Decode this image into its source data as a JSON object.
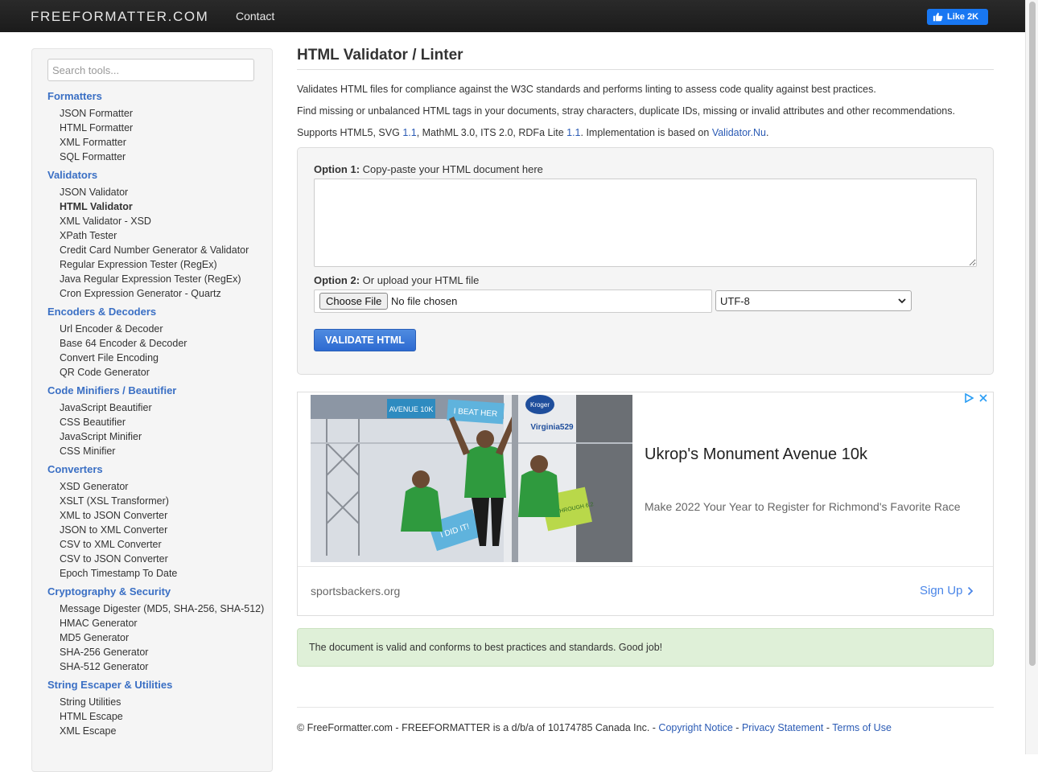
{
  "topbar": {
    "brand": "FREEFORMATTER.COM",
    "contact": "Contact",
    "like_label": "Like 2K"
  },
  "sidebar": {
    "search_placeholder": "Search tools...",
    "categories": [
      {
        "title": "Formatters",
        "items": [
          "JSON Formatter",
          "HTML Formatter",
          "XML Formatter",
          "SQL Formatter"
        ]
      },
      {
        "title": "Validators",
        "items": [
          "JSON Validator",
          "HTML Validator",
          "XML Validator - XSD",
          "XPath Tester",
          "Credit Card Number Generator & Validator",
          "Regular Expression Tester (RegEx)",
          "Java Regular Expression Tester (RegEx)",
          "Cron Expression Generator - Quartz"
        ]
      },
      {
        "title": "Encoders & Decoders",
        "items": [
          "Url Encoder & Decoder",
          "Base 64 Encoder & Decoder",
          "Convert File Encoding",
          "QR Code Generator"
        ]
      },
      {
        "title": "Code Minifiers / Beautifier",
        "items": [
          "JavaScript Beautifier",
          "CSS Beautifier",
          "JavaScript Minifier",
          "CSS Minifier"
        ]
      },
      {
        "title": "Converters",
        "items": [
          "XSD Generator",
          "XSLT (XSL Transformer)",
          "XML to JSON Converter",
          "JSON to XML Converter",
          "CSV to XML Converter",
          "CSV to JSON Converter",
          "Epoch Timestamp To Date"
        ]
      },
      {
        "title": "Cryptography & Security",
        "items": [
          "Message Digester (MD5, SHA-256, SHA-512)",
          "HMAC Generator",
          "MD5 Generator",
          "SHA-256 Generator",
          "SHA-512 Generator"
        ]
      },
      {
        "title": "String Escaper & Utilities",
        "items": [
          "String Utilities",
          "HTML Escape",
          "XML Escape"
        ]
      }
    ],
    "active_item": "HTML Validator"
  },
  "main": {
    "title": "HTML Validator / Linter",
    "intro_1": "Validates HTML files for compliance against the W3C standards and performs linting to assess code quality against best practices.",
    "intro_2": "Find missing or unbalanced HTML tags in your documents, stray characters, duplicate IDs, missing or invalid attributes and other recommendations.",
    "intro_3": {
      "t1": "Supports HTML5, SVG ",
      "l1": "1.1",
      "t2": ", MathML 3.0, ITS 2.0, RDFa Lite ",
      "l2": "1.1",
      "t3": ". Implementation is based on ",
      "l3": "Validator.Nu",
      "t4": "."
    }
  },
  "form": {
    "option1_bold": "Option 1:",
    "option1_text": " Copy-paste your HTML document here",
    "option2_bold": "Option 2:",
    "option2_text": " Or upload your HTML file",
    "choose_file": "Choose File",
    "no_file": "No file chosen",
    "encoding": "UTF-8",
    "validate_button": "VALIDATE HTML"
  },
  "ad": {
    "headline": "Ukrop's Monument Avenue 10k",
    "description": "Make 2022 Your Year to Register for Richmond's Favorite Race",
    "domain": "sportsbackers.org",
    "cta": "Sign Up",
    "image_signs": [
      "I BEAT HER",
      "I DID IT!",
      "I GOT THROUGH 6.2",
      "AVENUE 10K",
      "Kroger",
      "Virginia529"
    ]
  },
  "result": {
    "message": "The document is valid and conforms to best practices and standards. Good job!"
  },
  "footer": {
    "text": "© FreeFormatter.com - FREEFORMATTER is a d/b/a of 10174785 Canada Inc. - ",
    "copyright": "Copyright Notice",
    "sep1": " - ",
    "privacy": "Privacy Statement",
    "sep2": " - ",
    "terms": "Terms of Use"
  },
  "colors": {
    "link": "#3a6fc4",
    "button": "#2d6ad1",
    "success_bg": "#dff0d8",
    "topbar": "#1f1f1f",
    "facebook": "#1877f2"
  }
}
